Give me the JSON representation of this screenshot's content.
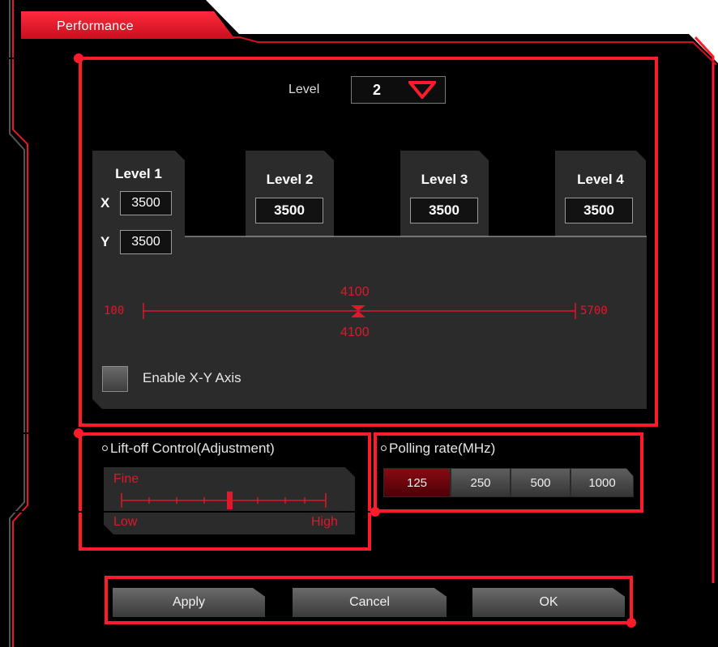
{
  "tab": {
    "title": "Performance"
  },
  "level_selector": {
    "label": "Level",
    "value": "2"
  },
  "levels": [
    {
      "title": "Level 1",
      "x": "3500",
      "y": "3500",
      "x_label": "X",
      "y_label": "Y"
    },
    {
      "title": "Level 2",
      "value": "3500"
    },
    {
      "title": "Level 3",
      "value": "3500"
    },
    {
      "title": "Level 4",
      "value": "3500"
    }
  ],
  "dpi_slider": {
    "min": "100",
    "max": "5700",
    "value_top": "4100",
    "value_bottom": "4100"
  },
  "xy_axis": {
    "label": "Enable X-Y Axis",
    "checked": false
  },
  "liftoff": {
    "title": "Lift-off Control(Adjustment)",
    "fine_label": "Fine",
    "low_label": "Low",
    "high_label": "High",
    "level": 0.5
  },
  "polling": {
    "title": "Polling rate(MHz)",
    "options": [
      "125",
      "250",
      "500",
      "1000"
    ],
    "selected": "125"
  },
  "buttons": {
    "apply": "Apply",
    "cancel": "Cancel",
    "ok": "OK"
  },
  "colors": {
    "accent": "#e0182a",
    "background": "#000000",
    "panel": "#2b2b2b"
  }
}
